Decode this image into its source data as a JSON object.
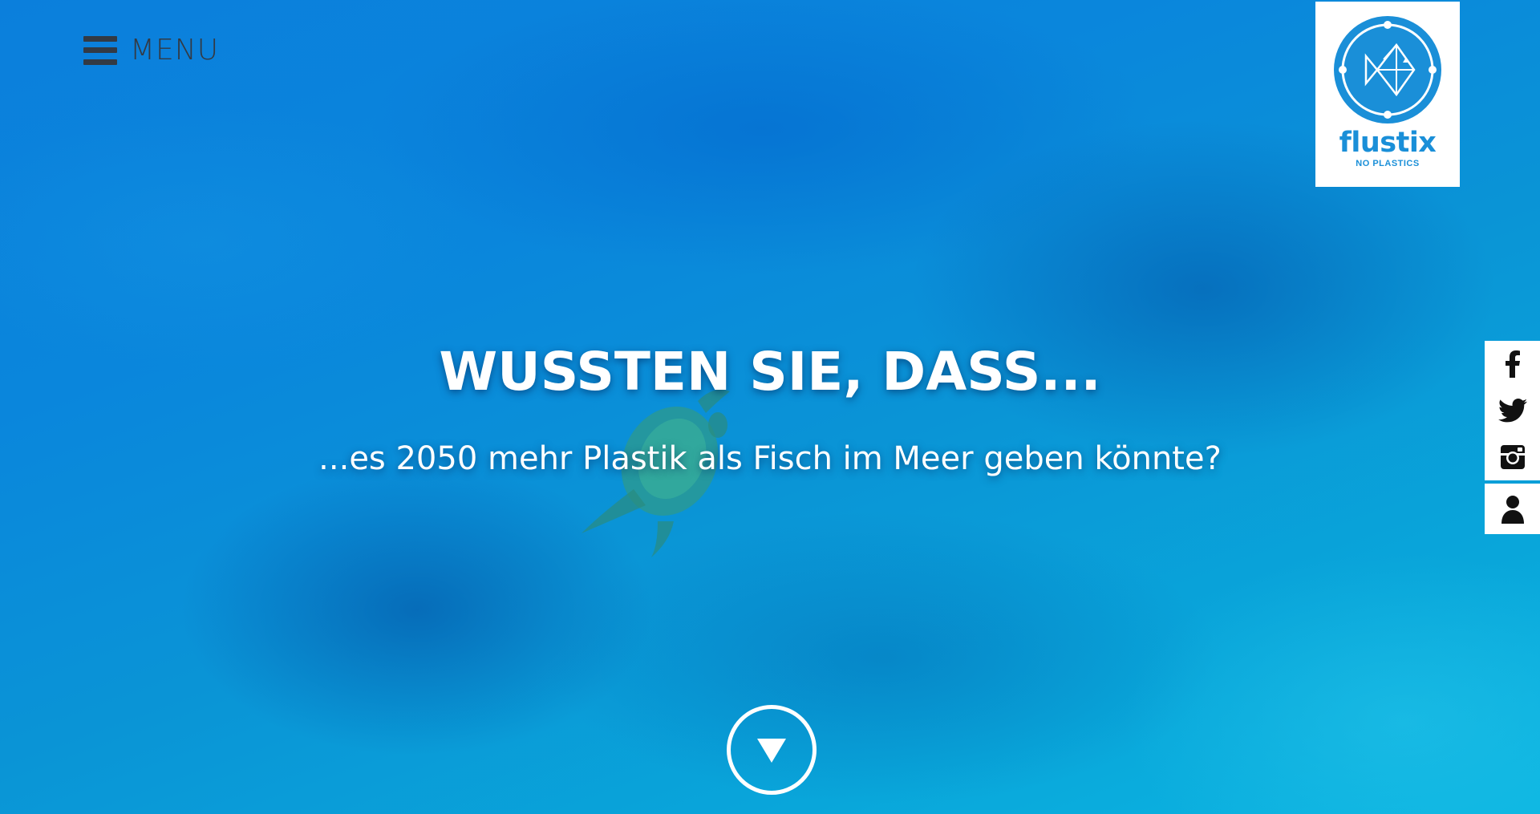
{
  "menu": {
    "label": "MENU",
    "icon": "hamburger-icon"
  },
  "logo": {
    "name": "flustix",
    "tagline": "NO PLASTICS",
    "icon": "fish-icon",
    "color": "#1a8fd8"
  },
  "hero": {
    "headline": "WUSSTEN SIE, DASS...",
    "subline": "...es 2050 mehr Plastik als Fisch im Meer geben könnte?",
    "scroll_icon": "triangle-down-icon"
  },
  "social": {
    "items": [
      {
        "icon": "facebook-icon"
      },
      {
        "icon": "twitter-icon"
      },
      {
        "icon": "instagram-icon"
      },
      {
        "icon": "user-icon"
      }
    ]
  },
  "colors": {
    "background": "#0a8ad9",
    "text": "#ffffff",
    "menu": "#333a44"
  }
}
